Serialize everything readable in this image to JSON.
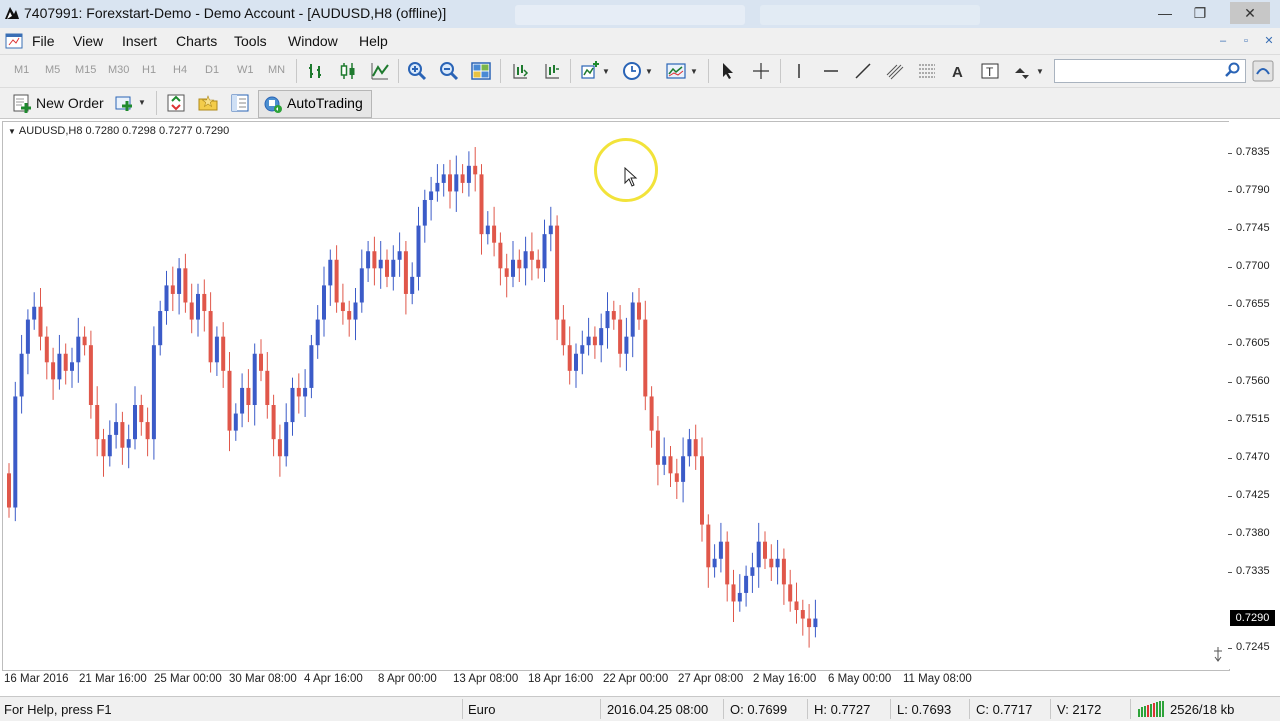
{
  "window": {
    "title": "7407991: Forexstart-Demo - Demo Account - [AUDUSD,H8 (offline)]",
    "buttons": {
      "minimize": "—",
      "maximize": "❐",
      "close": "✕"
    }
  },
  "menu": {
    "items": [
      "File",
      "View",
      "Insert",
      "Charts",
      "Tools",
      "Window",
      "Help"
    ]
  },
  "timeframes": [
    "M1",
    "M5",
    "M15",
    "M30",
    "H1",
    "H4",
    "D1",
    "W1",
    "MN"
  ],
  "search": {
    "placeholder": "",
    "icon": "search-icon"
  },
  "toolbar2": {
    "new_order_label": "New Order",
    "autotrading_label": "AutoTrading"
  },
  "chart": {
    "header": "AUDUSD,H8  0.7280 0.7298 0.7277 0.7290",
    "current_price": "0.7290",
    "up_color": "#3b5bc8",
    "down_color": "#e0574a",
    "price_ticks": [
      "0.7835",
      "0.7790",
      "0.7745",
      "0.7700",
      "0.7655",
      "0.7605",
      "0.7560",
      "0.7515",
      "0.7470",
      "0.7425",
      "0.7380",
      "0.7335",
      "0.7290",
      "0.7245"
    ],
    "time_ticks": [
      "16 Mar 2016",
      "21 Mar 16:00",
      "25 Mar 00:00",
      "30 Mar 08:00",
      "4 Apr 16:00",
      "8 Apr 00:00",
      "13 Apr 08:00",
      "18 Apr 16:00",
      "22 Apr 00:00",
      "27 Apr 08:00",
      "2 May 16:00",
      "6 May 00:00",
      "11 May 08:00"
    ]
  },
  "chart_data": {
    "type": "candlestick",
    "symbol": "AUDUSD",
    "timeframe": "H8",
    "ylim": [
      0.7235,
      0.7855
    ],
    "closes": [
      0.742,
      0.755,
      0.76,
      0.764,
      0.7655,
      0.762,
      0.759,
      0.757,
      0.76,
      0.758,
      0.759,
      0.762,
      0.761,
      0.754,
      0.75,
      0.748,
      0.7505,
      0.752,
      0.749,
      0.75,
      0.754,
      0.752,
      0.75,
      0.761,
      0.765,
      0.768,
      0.767,
      0.77,
      0.766,
      0.764,
      0.767,
      0.765,
      0.759,
      0.762,
      0.758,
      0.751,
      0.753,
      0.756,
      0.754,
      0.76,
      0.758,
      0.754,
      0.75,
      0.748,
      0.752,
      0.756,
      0.755,
      0.756,
      0.761,
      0.764,
      0.768,
      0.771,
      0.766,
      0.765,
      0.764,
      0.766,
      0.77,
      0.772,
      0.77,
      0.771,
      0.769,
      0.771,
      0.772,
      0.767,
      0.769,
      0.775,
      0.778,
      0.779,
      0.78,
      0.781,
      0.779,
      0.781,
      0.78,
      0.782,
      0.781,
      0.774,
      0.775,
      0.773,
      0.77,
      0.769,
      0.771,
      0.77,
      0.772,
      0.771,
      0.77,
      0.774,
      0.775,
      0.764,
      0.761,
      0.758,
      0.76,
      0.761,
      0.762,
      0.761,
      0.763,
      0.765,
      0.764,
      0.76,
      0.762,
      0.766,
      0.764,
      0.755,
      0.751,
      0.747,
      0.748,
      0.746,
      0.745,
      0.748,
      0.75,
      0.748,
      0.74,
      0.735,
      0.736,
      0.738,
      0.733,
      0.731,
      0.732,
      0.734,
      0.735,
      0.738,
      0.736,
      0.735,
      0.736,
      0.733,
      0.731,
      0.73,
      0.729,
      0.728,
      0.729
    ],
    "open": 0.728,
    "high": 0.7298,
    "low": 0.7277,
    "close": 0.729
  },
  "status": {
    "help": "For Help, press F1",
    "profile": "Euro",
    "datetime": "2016.04.25 08:00",
    "open": "O: 0.7699",
    "high": "H: 0.7727",
    "low": "L: 0.7693",
    "close": "C: 0.7717",
    "volume": "V: 2172",
    "traffic": "2526/18 kb"
  }
}
